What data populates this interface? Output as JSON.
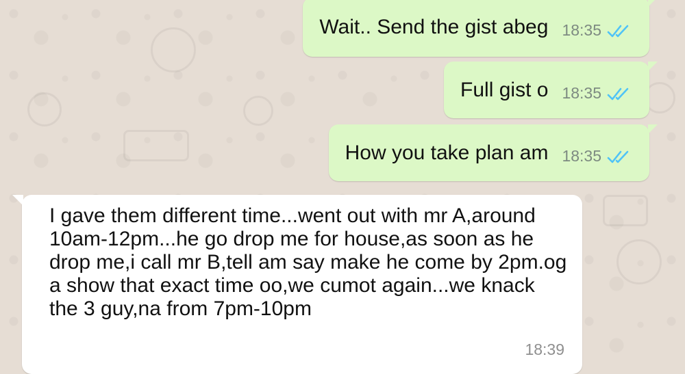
{
  "chat": {
    "messages": [
      {
        "direction": "outgoing",
        "text": "Wait.. Send the gist abeg",
        "time": "18:35",
        "status_icon": "double-check-read-icon"
      },
      {
        "direction": "outgoing",
        "text": "Full gist o",
        "time": "18:35",
        "status_icon": "double-check-read-icon"
      },
      {
        "direction": "outgoing",
        "text": "How you take plan am",
        "time": "18:35",
        "status_icon": "double-check-read-icon"
      },
      {
        "direction": "incoming",
        "text": "I gave them different time...went out with mr A,around 10am-12pm...he go drop me for house,as soon as he drop me,i call mr B,tell am say make he come by 2pm.og a show that exact time oo,we cumot again...we knack\nthe 3 guy,na from 7pm-10pm",
        "time": "18:39"
      }
    ]
  },
  "colors": {
    "wallpaper": "#e6ddd4",
    "outgoing_bubble": "#dcf8c6",
    "incoming_bubble": "#ffffff",
    "read_tick": "#4fc3f7"
  }
}
